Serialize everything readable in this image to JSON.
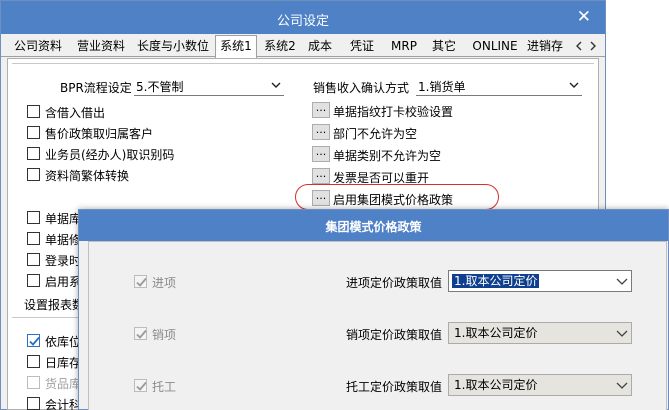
{
  "main_window": {
    "title": "公司设定",
    "close_glyph": "✕"
  },
  "tabs": [
    "公司资料",
    "营业资料",
    "长度与小数位",
    "系统1",
    "系统2",
    "成本",
    "凭证",
    "MRP",
    "其它",
    "ONLINE",
    "进销存"
  ],
  "active_tab": "系统1",
  "settings": {
    "bpr_label": "BPR流程设定",
    "bpr_value": "5.不管制",
    "sales_label": "销售收入确认方式",
    "sales_value": "1.销货单",
    "left_checks": [
      {
        "label": "含借入借出",
        "checked": false
      },
      {
        "label": "售价政策取归属客户",
        "checked": false
      },
      {
        "label": "业务员(经办人)取识别码",
        "checked": false
      },
      {
        "label": "资料简繁体转换",
        "checked": false
      }
    ],
    "left_checks_partial": [
      {
        "label": "单据库",
        "checked": false
      },
      {
        "label": "单据修",
        "checked": false
      },
      {
        "label": "登录时",
        "checked": false
      },
      {
        "label": "启用系",
        "checked": false
      }
    ],
    "report_label": "设置报表数",
    "lower_checks": [
      {
        "label": "依库位",
        "checked": true,
        "disabled": false
      },
      {
        "label": "日库存",
        "checked": false,
        "disabled": false
      },
      {
        "label": "货品库",
        "checked": false,
        "disabled": true
      },
      {
        "label": "会计科",
        "checked": false,
        "disabled": false
      }
    ],
    "dots_glyph": "...",
    "right_buttons": [
      "单据指纹打卡校验设置",
      "部门不允许为空",
      "单据类别不允许为空",
      "发票是否可以重开",
      "启用集团模式价格政策"
    ]
  },
  "dialog": {
    "title": "集团模式价格政策",
    "rows": [
      {
        "check_label": "进项",
        "checked": true,
        "field_label": "进项定价政策取值",
        "value": "1.取本公司定价",
        "focused": true
      },
      {
        "check_label": "销项",
        "checked": true,
        "field_label": "销项定价政策取值",
        "value": "1.取本公司定价",
        "focused": false
      },
      {
        "check_label": "托工",
        "checked": true,
        "field_label": "托工定价政策取值",
        "value": "1.取本公司定价",
        "focused": false
      }
    ]
  },
  "colors": {
    "title_bar": "#4f81c7",
    "highlight_oval": "#d62f2f",
    "selection": "#0f3f8f",
    "check_mark": "#2a6fc9"
  }
}
